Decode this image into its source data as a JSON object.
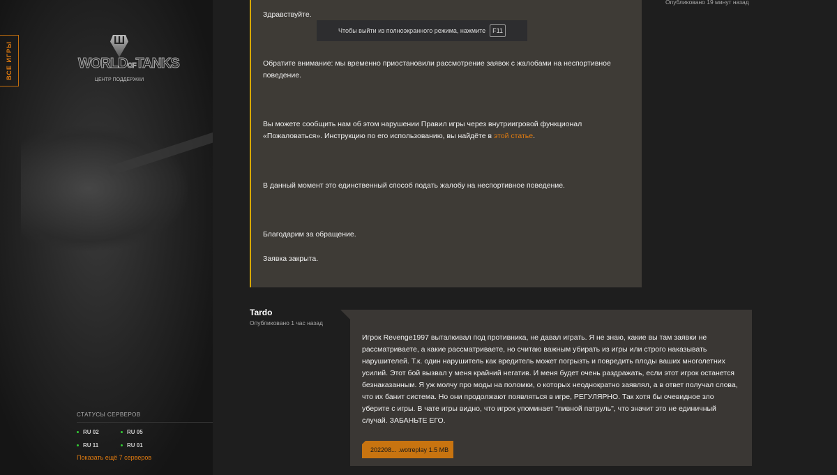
{
  "sidebar": {
    "all_games": "ВСЕ ИГРЫ",
    "logo_text": "WORLD of TANKS",
    "support_center": "ЦЕНТР ПОДДЕРЖКИ",
    "server_status": {
      "title": "СТАТУСЫ СЕРВЕРОВ",
      "servers": [
        "RU 02",
        "RU 05",
        "RU 11",
        "RU 01"
      ],
      "show_more": "Показать ещё 7 серверов"
    }
  },
  "answer": {
    "published": "Опубликовано 19 минут назад",
    "greeting": "Здравствуйте.",
    "p1": "Обратите внимание: мы временно приостановили рассмотрение заявок с жалобами на неспортивное поведение.",
    "p2_a": "Вы можете сообщить нам об этом нарушении Правил игры через внутриигровой функционал «Пожаловаться». Инструкцию по его использованию, вы найдёте в ",
    "p2_link": "этой статье",
    "p2_b": ".",
    "p3": "В данный момент это единственный способ подать жалобу на неспортивное поведение.",
    "p4": "Благодарим за обращение.",
    "p5": "Заявка закрыта."
  },
  "toast": {
    "text": "Чтобы выйти из полноэкранного режима, нажмите",
    "key": "F11"
  },
  "message": {
    "author": "Tardo",
    "published": "Опубликовано 1 час назад",
    "text": "Игрок Revenge1997 выталкивал под противника, не давал играть. Я не знаю, какие вы там заявки не рассматриваете, а какие рассматриваете, но считаю важным убирать из игры или строго наказывать нарушителей. Т.к. один нарушитель как вредитель может погрызть и повредить плоды ваших многолетних усилий. Этот бой вызвал у меня крайний негатив. И меня будет очень раздражать, если этот игрок останется безнаказанным. Я уж молчу про моды на поломки, о которых неоднократно заявлял, а в ответ получал слова, что их банит система. Но они продолжают появляться в игре, РЕГУЛЯРНО. Так хотя бы очевидное зло уберите с игры. В чате игры видно, что игрок упоминает \"пивной патруль\", что значит это не единичный случай. ЗАБАНЬТЕ ЕГО.",
    "attachment": {
      "name": "202208... .wotreplay",
      "size": "1.5 MB"
    }
  }
}
